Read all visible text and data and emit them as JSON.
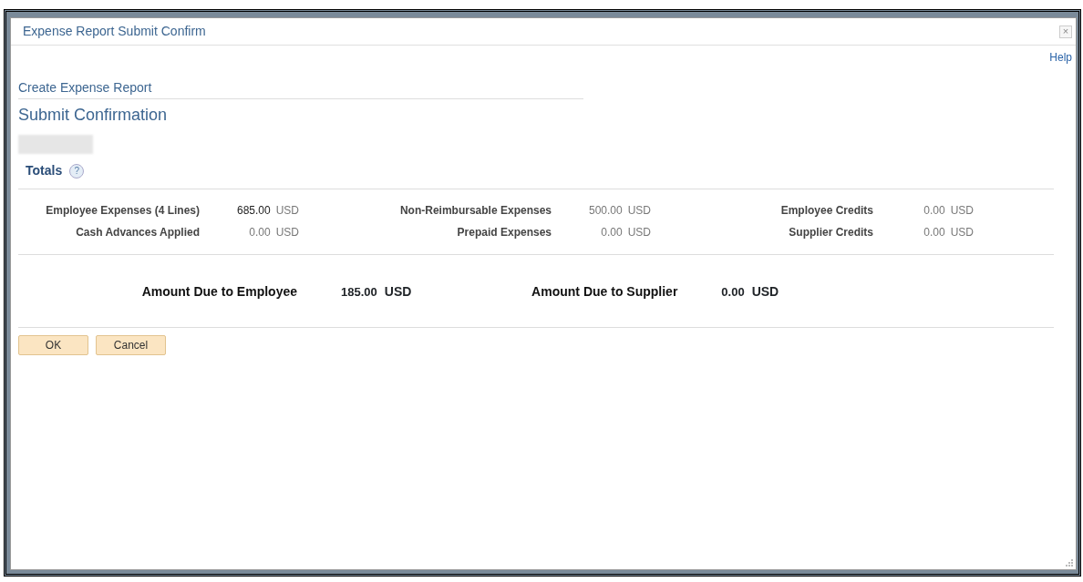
{
  "dialog": {
    "title": "Expense Report Submit Confirm",
    "close": "×",
    "help": "Help"
  },
  "breadcrumb": "Create Expense Report",
  "page_title": "Submit Confirmation",
  "totals": {
    "heading": "Totals",
    "help_icon": "?",
    "items": [
      {
        "label": "Employee Expenses (4 Lines)",
        "amount": "685.00",
        "currency": "USD",
        "emphasis": true
      },
      {
        "label": "Non-Reimbursable Expenses",
        "amount": "500.00",
        "currency": "USD",
        "emphasis": false
      },
      {
        "label": "Employee Credits",
        "amount": "0.00",
        "currency": "USD",
        "emphasis": false
      },
      {
        "label": "Cash Advances Applied",
        "amount": "0.00",
        "currency": "USD",
        "emphasis": false
      },
      {
        "label": "Prepaid Expenses",
        "amount": "0.00",
        "currency": "USD",
        "emphasis": false
      },
      {
        "label": "Supplier Credits",
        "amount": "0.00",
        "currency": "USD",
        "emphasis": false
      }
    ]
  },
  "due": [
    {
      "label": "Amount Due to Employee",
      "amount": "185.00",
      "currency": "USD"
    },
    {
      "label": "Amount Due to Supplier",
      "amount": "0.00",
      "currency": "USD"
    }
  ],
  "buttons": [
    "OK",
    "Cancel"
  ]
}
